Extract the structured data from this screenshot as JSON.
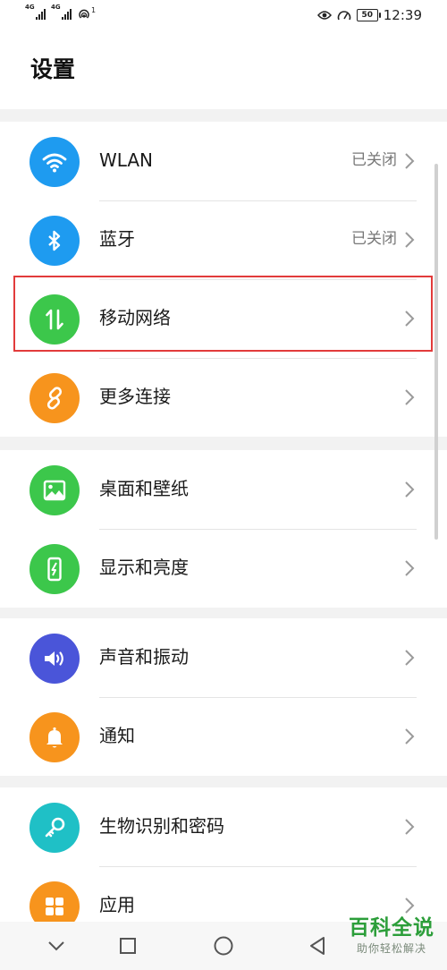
{
  "status_bar": {
    "sim1_label": "4G",
    "sim2_label": "4G",
    "hotspot_badge": "1",
    "battery": "50",
    "time": "12:39",
    "icons": [
      "signal-icon",
      "hotspot-icon",
      "eye-icon",
      "speed-icon",
      "battery-icon"
    ]
  },
  "header": {
    "title": "设置"
  },
  "groups": [
    {
      "items": [
        {
          "name": "wlan",
          "label": "WLAN",
          "value": "已关闭",
          "icon": "wifi-icon",
          "color": "#1e9bf0"
        },
        {
          "name": "bluetooth",
          "label": "蓝牙",
          "value": "已关闭",
          "icon": "bluetooth-icon",
          "color": "#1e9bf0"
        },
        {
          "name": "mobile-network",
          "label": "移动网络",
          "value": "",
          "icon": "mobile-data-icon",
          "color": "#3cc74b"
        },
        {
          "name": "more-connections",
          "label": "更多连接",
          "value": "",
          "icon": "link-icon",
          "color": "#f7941d"
        }
      ]
    },
    {
      "items": [
        {
          "name": "wallpaper",
          "label": "桌面和壁纸",
          "value": "",
          "icon": "image-icon",
          "color": "#3cc74b"
        },
        {
          "name": "display",
          "label": "显示和亮度",
          "value": "",
          "icon": "phone-brightness-icon",
          "color": "#3cc74b"
        }
      ]
    },
    {
      "items": [
        {
          "name": "sound",
          "label": "声音和振动",
          "value": "",
          "icon": "speaker-icon",
          "color": "#4a55d9"
        },
        {
          "name": "notifications",
          "label": "通知",
          "value": "",
          "icon": "bell-icon",
          "color": "#f7941d"
        }
      ]
    },
    {
      "items": [
        {
          "name": "biometrics",
          "label": "生物识别和密码",
          "value": "",
          "icon": "key-icon",
          "color": "#1fc0c6"
        },
        {
          "name": "apps",
          "label": "应用",
          "value": "",
          "icon": "apps-icon",
          "color": "#f7941d"
        }
      ]
    }
  ],
  "highlight_color": "#e23b3b",
  "nav": {
    "icons": [
      "back-icon",
      "home-icon",
      "recents-icon",
      "collapse-icon"
    ]
  },
  "watermark": {
    "main": "百科全说",
    "sub": "助你轻松解决"
  }
}
